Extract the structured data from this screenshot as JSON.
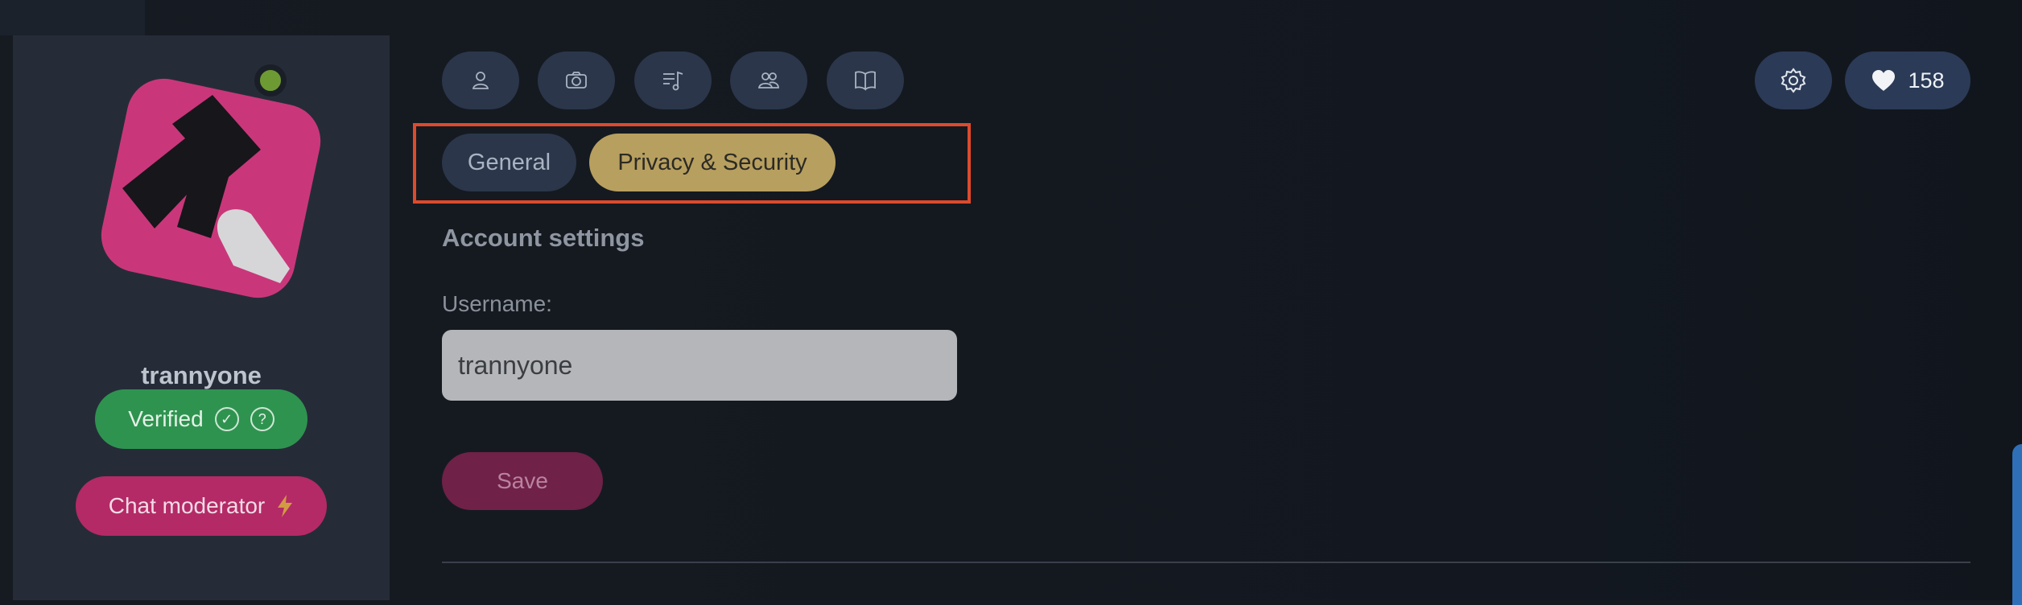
{
  "profile": {
    "username": "trannyone",
    "verified_label": "Verified",
    "moderator_label": "Chat moderator",
    "colors": {
      "online": "#6e9a34",
      "verified": "#2f9350",
      "moderator": "#b32a66"
    }
  },
  "nav_tabs": [
    {
      "icon": "user-icon"
    },
    {
      "icon": "camera-icon"
    },
    {
      "icon": "playlist-icon"
    },
    {
      "icon": "friends-icon"
    },
    {
      "icon": "book-icon"
    }
  ],
  "header": {
    "likes_count": "158"
  },
  "settings_tabs": {
    "general": "General",
    "privacy": "Privacy & Security",
    "active": "Privacy & Security"
  },
  "account": {
    "section_title": "Account settings",
    "username_label": "Username:",
    "username_value": "trannyone",
    "save_label": "Save"
  },
  "colors": {
    "background": "#151a21",
    "accent_active_tab": "#b79f5f",
    "highlight_box": "#dd4a2c",
    "save_button": "#6f2148"
  }
}
